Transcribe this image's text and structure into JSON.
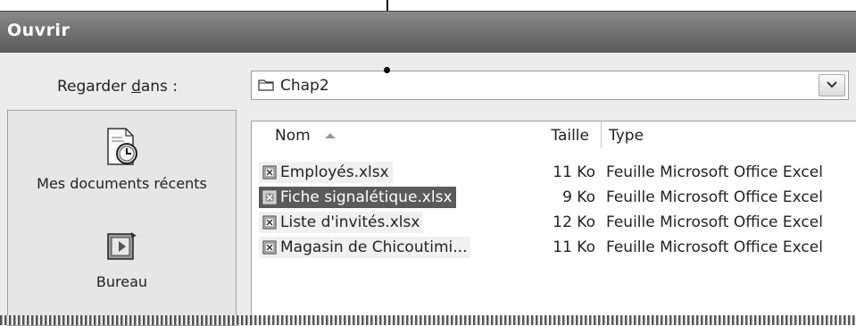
{
  "window": {
    "title": "Ouvrir"
  },
  "look_in": {
    "label_before": "Regarder ",
    "label_accel": "d",
    "label_after": "ans :",
    "value": "Chap2",
    "dropdown_icon": "chevron-down-icon"
  },
  "places": [
    {
      "label": "Mes documents récents",
      "icon": "recent-documents-icon"
    },
    {
      "label": "Bureau",
      "icon": "desktop-icon"
    }
  ],
  "file_list": {
    "columns": {
      "name": "Nom",
      "size": "Taille",
      "type": "Type"
    },
    "rows": [
      {
        "name": "Employés.xlsx",
        "size": "11 Ko",
        "type": "Feuille Microsoft Office Excel",
        "selected": false
      },
      {
        "name": "Fiche signalétique.xlsx",
        "size": "9 Ko",
        "type": "Feuille Microsoft Office Excel",
        "selected": true
      },
      {
        "name": "Liste d'invités.xlsx",
        "size": "12 Ko",
        "type": "Feuille Microsoft Office Excel",
        "selected": false
      },
      {
        "name": "Magasin de Chicoutimi...",
        "size": "11 Ko",
        "type": "Feuille Microsoft Office Excel",
        "selected": false
      }
    ]
  },
  "colors": {
    "titlebar": "#6e6e6e",
    "selection": "#5a5a5a",
    "dialog_bg": "#ececec"
  }
}
